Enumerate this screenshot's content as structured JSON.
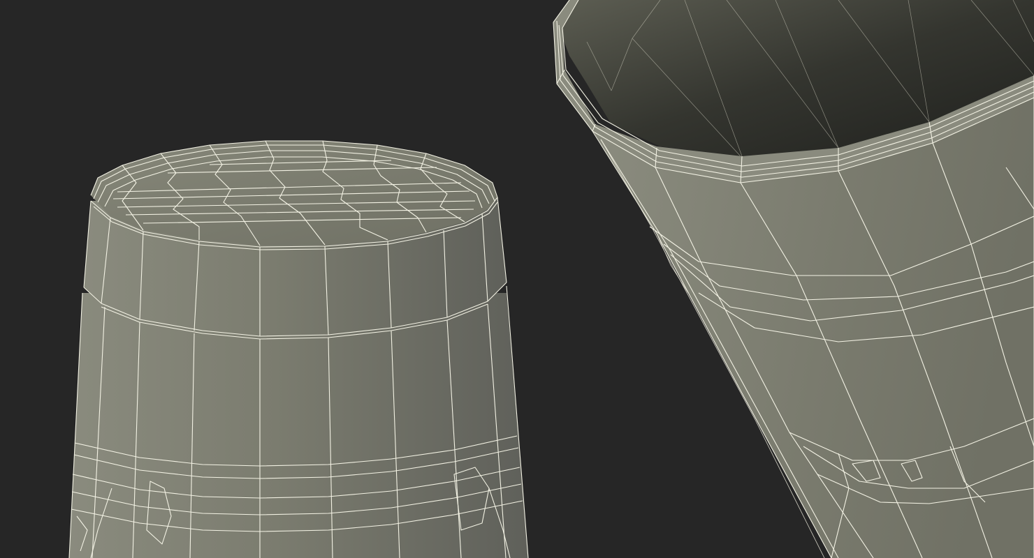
{
  "scene": {
    "background": "#262626",
    "mesh_fill": "#7a7b6d",
    "wire_color": "#f3f2e4",
    "objects": [
      {
        "name": "closed-bucket",
        "view": "lid-top",
        "segments": 14
      },
      {
        "name": "open-bucket",
        "view": "interior",
        "segments": 14
      }
    ]
  }
}
